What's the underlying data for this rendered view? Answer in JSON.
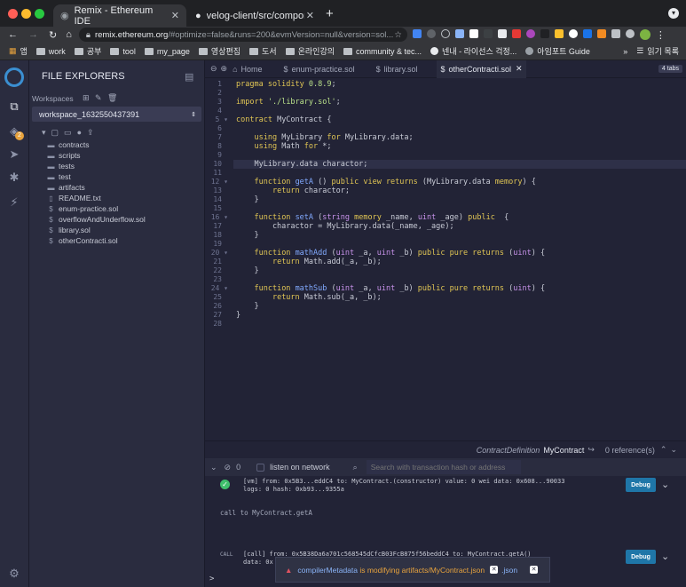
{
  "browser": {
    "tabs": [
      {
        "title": "Remix - Ethereum IDE"
      },
      {
        "title": "velog-client/src/components a"
      }
    ],
    "url_host": "remix.ethereum.org",
    "url_rest": "/#optimize=false&runs=200&evmVersion=null&version=sol...",
    "bookmarks": [
      "앱",
      "work",
      "공부",
      "tool",
      "my_page",
      "영상편집",
      "도서",
      "온라인강의",
      "community & tec...",
      "넨내 - 라이선스 걱정...",
      "아임포트 Guide",
      "읽기 목록"
    ]
  },
  "sidebar": {
    "badge": "2"
  },
  "file_explorer": {
    "title": "FILE EXPLORERS",
    "workspaces_label": "Workspaces",
    "workspace": "workspace_1632550437391",
    "items": [
      {
        "name": "contracts",
        "type": "folder"
      },
      {
        "name": "scripts",
        "type": "folder"
      },
      {
        "name": "tests",
        "type": "folder"
      },
      {
        "name": "test",
        "type": "folder"
      },
      {
        "name": "artifacts",
        "type": "folder"
      },
      {
        "name": "README.txt",
        "type": "file"
      },
      {
        "name": "enum-practice.sol",
        "type": "sol"
      },
      {
        "name": "overflowAndUnderflow.sol",
        "type": "sol"
      },
      {
        "name": "library.sol",
        "type": "sol"
      },
      {
        "name": "otherContracti.sol",
        "type": "sol"
      }
    ]
  },
  "editor_tabs": {
    "home": "Home",
    "files": [
      "enum-practice.sol",
      "library.sol",
      "otherContracti.sol"
    ],
    "count": "4 tabs"
  },
  "status": {
    "context": "ContractDefinition",
    "name": "MyContract",
    "refs": "0 reference(s)"
  },
  "terminal": {
    "count": "0",
    "listen": "listen on network",
    "search_placeholder": "Search with transaction hash or address",
    "tx1_line1": "[vm] from: 0x5B3...eddC4 to: MyContract.(constructor) value: 0 wei data: 0x608...90033",
    "tx1_line2": "logs: 0 hash: 0xb93...9355a",
    "call_text": "call to MyContract.getA",
    "call_tag": "CALL",
    "tx2_line1": "[call] from: 0x5B38Da6a701c568545dCfcB03FcB875f56beddC4 to: MyContract.getA()",
    "tx2_line2": "data: 0x",
    "debug": "Debug",
    "toast_a": "compilerMetadata",
    "toast_b": " is modifying ",
    "toast_c": "artifacts/MyContract.json",
    "toast_tail": ".json",
    "prompt": ">"
  }
}
